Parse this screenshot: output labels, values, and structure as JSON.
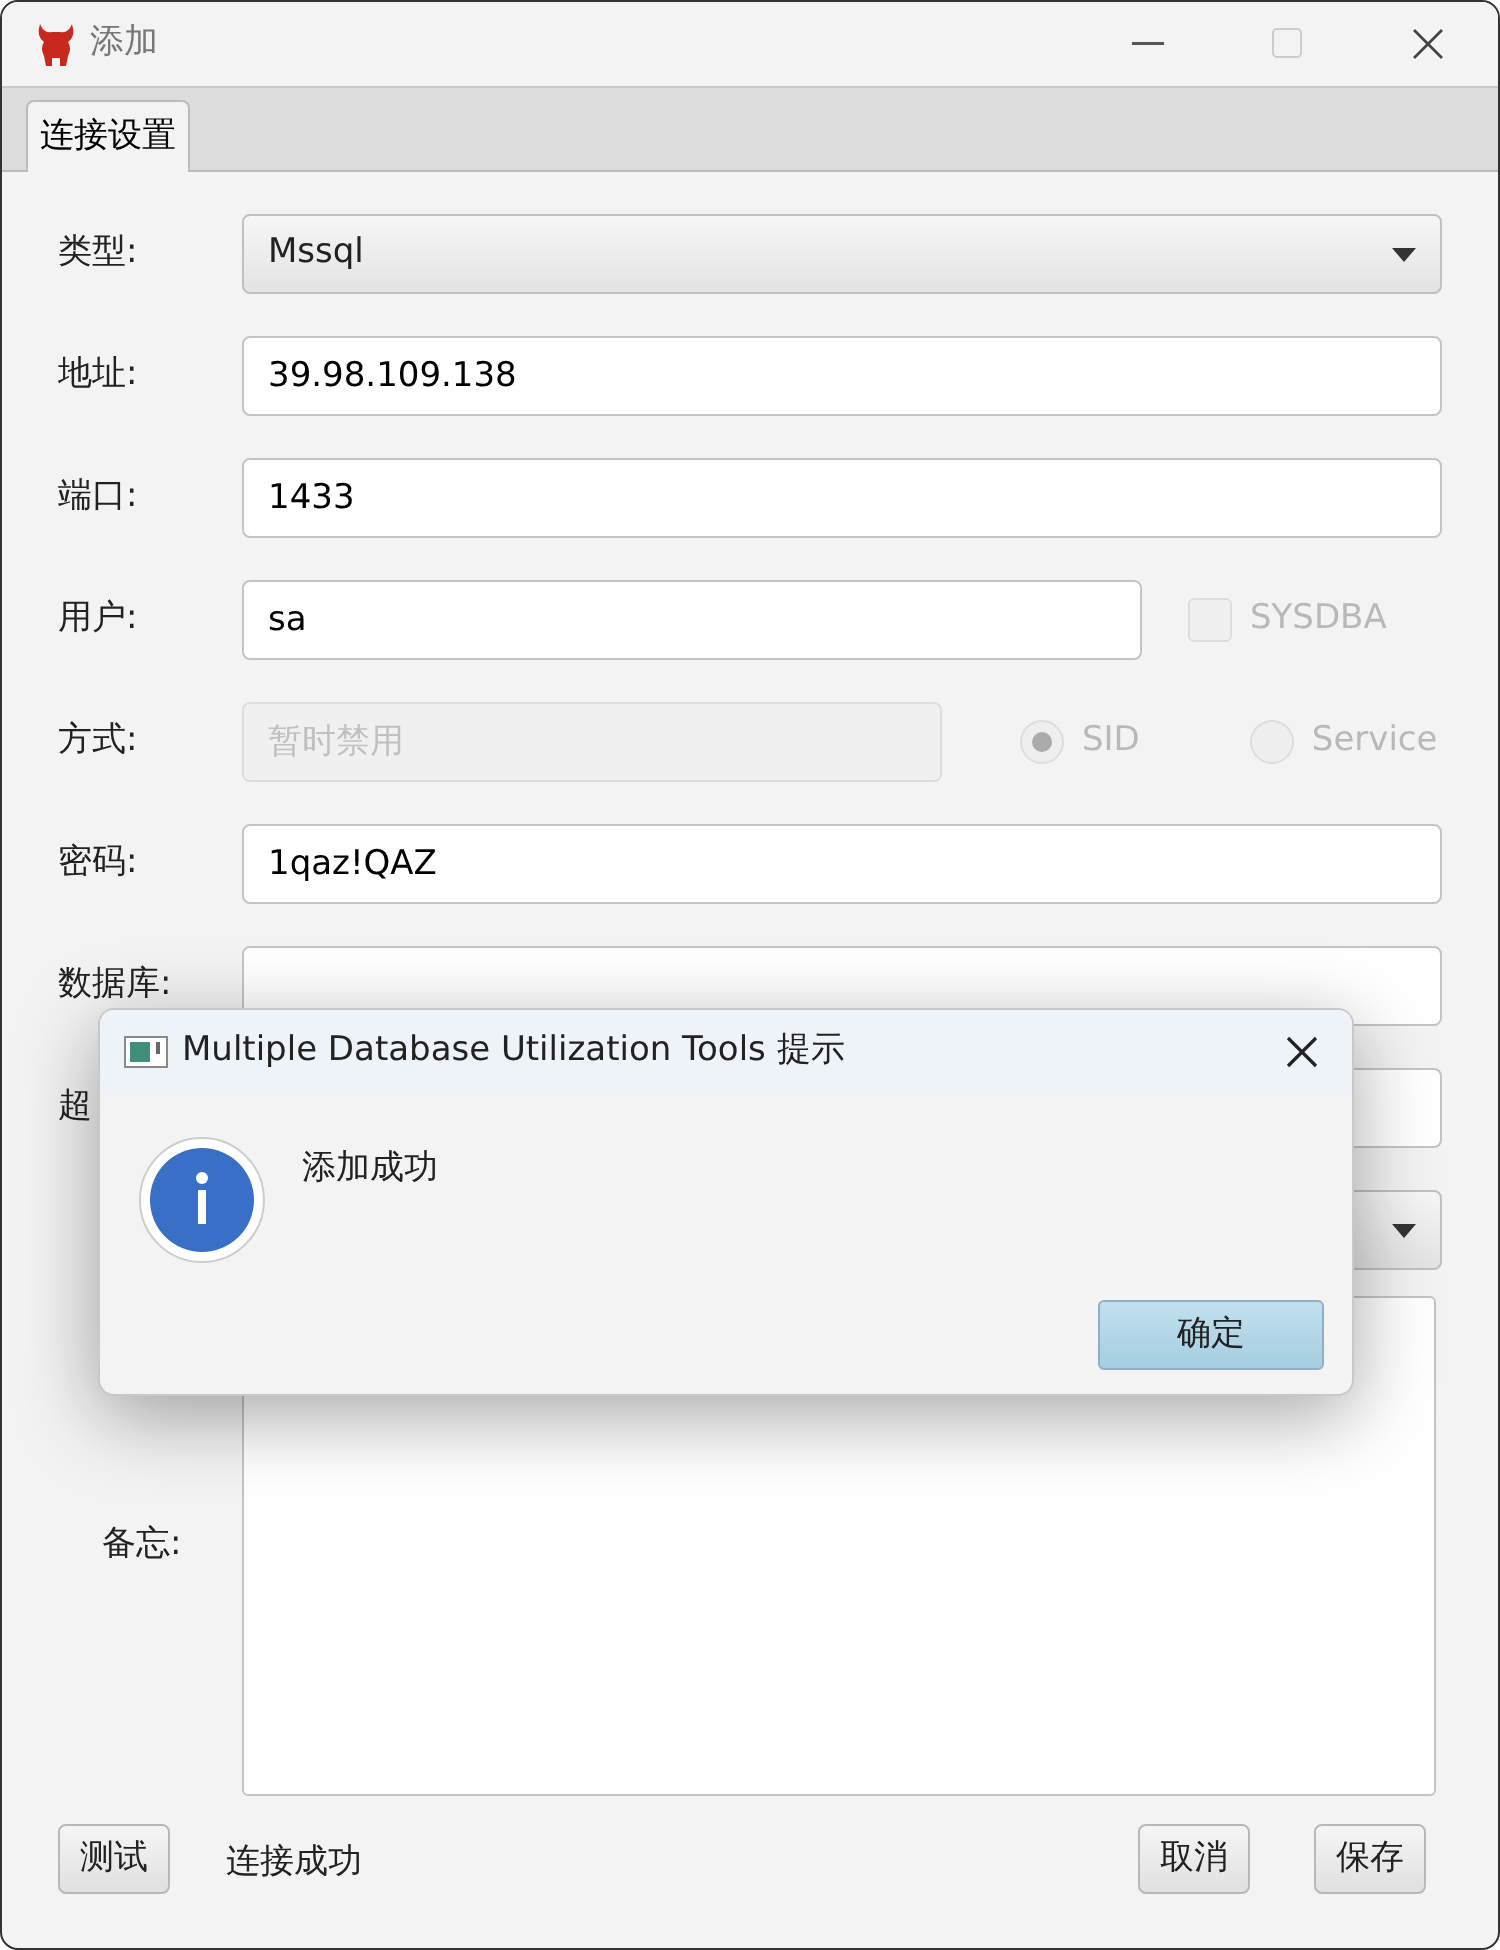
{
  "window": {
    "title": "添加"
  },
  "tabs": [
    {
      "label": "连接设置",
      "selected": true
    }
  ],
  "fields": [
    {
      "kind": "select",
      "label": "类型:",
      "value": "Mssql"
    },
    {
      "kind": "text",
      "label": "地址:",
      "value": "39.98.109.138"
    },
    {
      "kind": "text",
      "label": "端口:",
      "value": "1433"
    },
    {
      "kind": "text_check",
      "label": "用户:",
      "value": "sa",
      "checkbox": {
        "label": "SYSDBA",
        "checked": false,
        "disabled": true
      }
    },
    {
      "kind": "text_radio",
      "label": "方式:",
      "placeholder": "暂时禁用",
      "disabled": true,
      "radios": [
        {
          "label": "SID",
          "selected": true
        },
        {
          "label": "Service",
          "selected": false
        }
      ]
    },
    {
      "kind": "text",
      "label": "密码:",
      "value": "1qaz!QAZ"
    },
    {
      "kind": "text",
      "label": "数据库:"
    },
    {
      "kind": "text",
      "label": "超"
    },
    {
      "kind": "select"
    },
    {
      "kind": "textarea",
      "label": "备忘:"
    }
  ],
  "footer": {
    "test_button": "测试",
    "status": "连接成功",
    "cancel_button": "取消",
    "save_button": "保存"
  },
  "dialog": {
    "title": "Multiple Database Utilization Tools 提示",
    "message": "添加成功",
    "ok_button": "确定"
  }
}
